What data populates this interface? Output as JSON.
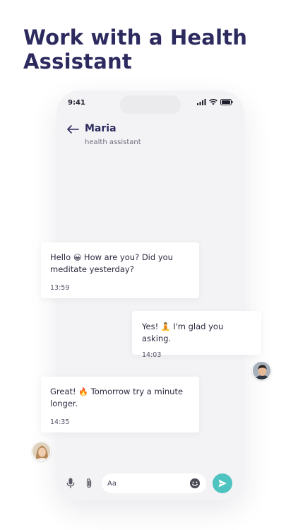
{
  "headline": "Work with a Health Assistant",
  "status": {
    "time": "9:41"
  },
  "chat": {
    "contact_name": "Maria",
    "contact_role": "health assistant",
    "messages": [
      {
        "pre": "Hello ",
        "emoji": "😀",
        "post": " How are you? Did you meditate yesterday?",
        "time": "13:59",
        "from": "assistant"
      },
      {
        "pre": "Yes! ",
        "emoji": "🧘",
        "post": " I'm glad you asking.",
        "time": "14:03",
        "from": "user"
      },
      {
        "pre": "Great! ",
        "emoji": "🔥",
        "post": " Tomorrow try a minute longer.",
        "time": "14:35",
        "from": "assistant"
      }
    ]
  },
  "composer": {
    "placeholder": "Aa"
  },
  "colors": {
    "accent": "#4ec3c0",
    "title": "#2c2a5e",
    "phone_bg": "#f3f3f5"
  },
  "icons": [
    "back-arrow-icon",
    "signal-icon",
    "wifi-icon",
    "battery-icon",
    "microphone-icon",
    "paperclip-icon",
    "emoji-icon",
    "send-icon"
  ]
}
